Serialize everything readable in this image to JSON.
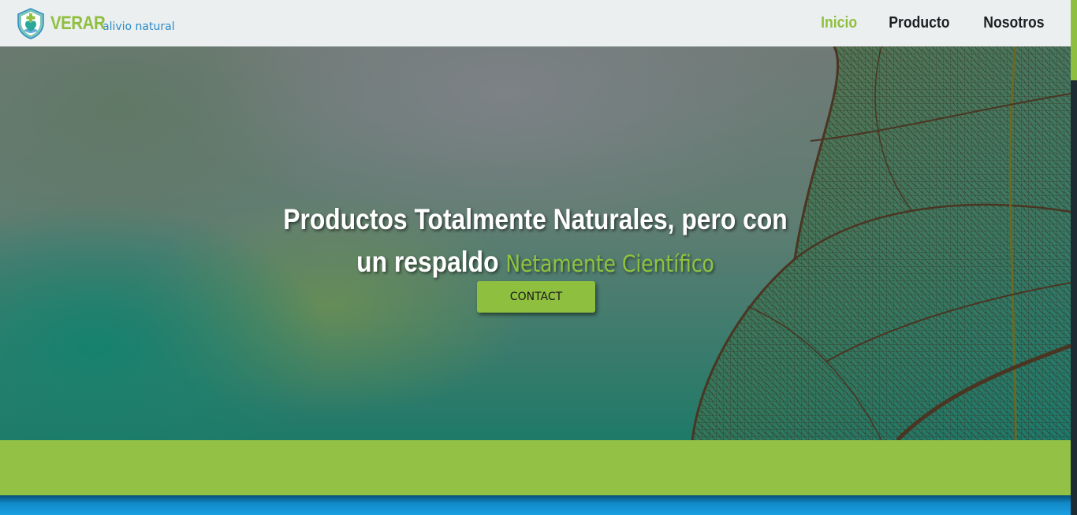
{
  "header": {
    "brand_name": "VERAR",
    "brand_tagline": "alivio natural",
    "nav": [
      {
        "label": "Inicio",
        "active": true
      },
      {
        "label": "Producto",
        "active": false
      },
      {
        "label": "Nosotros",
        "active": false
      }
    ]
  },
  "hero": {
    "title_line1": "Productos Totalmente Naturales, pero con",
    "title_line2_prefix": "un respaldo",
    "title_line2_highlight": "Netamente Científico",
    "contact_label": "CONTACT"
  },
  "colors": {
    "accent_green": "#8fbf3f",
    "brand_blue": "#2b8bc4",
    "header_bg": "#eceff0",
    "band_green": "#92c146",
    "strip_blue": "#1a9fe0"
  },
  "icons": {
    "logo": "shield-heart-leaf-icon",
    "hero_background": "leaf-vein-image"
  }
}
